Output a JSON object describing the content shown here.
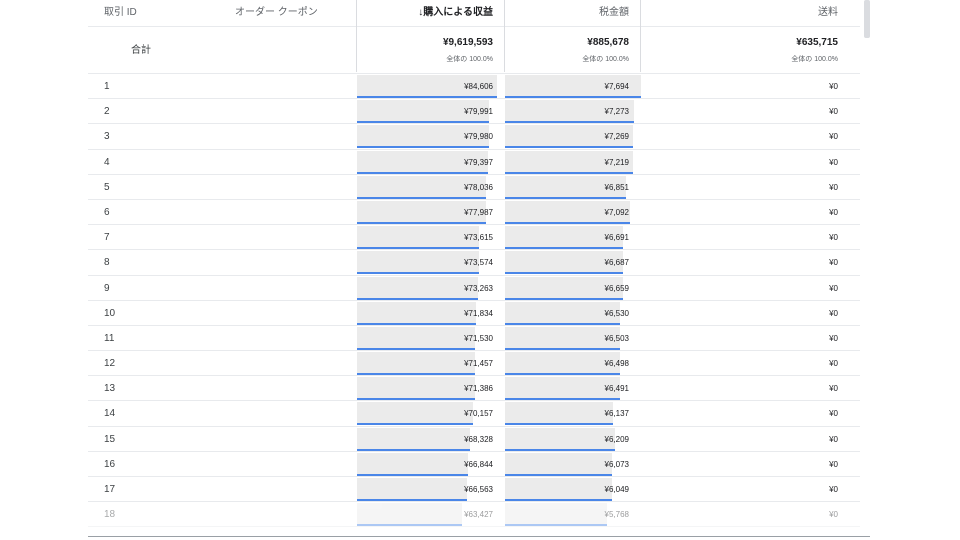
{
  "columns": {
    "transaction_id": "取引 ID",
    "order_coupon": "オーダー クーポン",
    "revenue": "↓購入による収益",
    "tax": "税金額",
    "shipping": "送料"
  },
  "totals": {
    "label": "合計",
    "revenue": "¥9,619,593",
    "revenue_pct": "全体の 100.0%",
    "tax": "¥885,678",
    "tax_pct": "全体の 100.0%",
    "shipping": "¥635,715",
    "shipping_pct": "全体の 100.0%"
  },
  "rows": [
    {
      "idx": "1",
      "revenue": "¥84,606",
      "tax": "¥7,694",
      "shipping": "¥0"
    },
    {
      "idx": "2",
      "revenue": "¥79,991",
      "tax": "¥7,273",
      "shipping": "¥0"
    },
    {
      "idx": "3",
      "revenue": "¥79,980",
      "tax": "¥7,269",
      "shipping": "¥0"
    },
    {
      "idx": "4",
      "revenue": "¥79,397",
      "tax": "¥7,219",
      "shipping": "¥0"
    },
    {
      "idx": "5",
      "revenue": "¥78,036",
      "tax": "¥6,851",
      "shipping": "¥0"
    },
    {
      "idx": "6",
      "revenue": "¥77,987",
      "tax": "¥7,092",
      "shipping": "¥0"
    },
    {
      "idx": "7",
      "revenue": "¥73,615",
      "tax": "¥6,691",
      "shipping": "¥0"
    },
    {
      "idx": "8",
      "revenue": "¥73,574",
      "tax": "¥6,687",
      "shipping": "¥0"
    },
    {
      "idx": "9",
      "revenue": "¥73,263",
      "tax": "¥6,659",
      "shipping": "¥0"
    },
    {
      "idx": "10",
      "revenue": "¥71,834",
      "tax": "¥6,530",
      "shipping": "¥0"
    },
    {
      "idx": "11",
      "revenue": "¥71,530",
      "tax": "¥6,503",
      "shipping": "¥0"
    },
    {
      "idx": "12",
      "revenue": "¥71,457",
      "tax": "¥6,498",
      "shipping": "¥0"
    },
    {
      "idx": "13",
      "revenue": "¥71,386",
      "tax": "¥6,491",
      "shipping": "¥0"
    },
    {
      "idx": "14",
      "revenue": "¥70,157",
      "tax": "¥6,137",
      "shipping": "¥0"
    },
    {
      "idx": "15",
      "revenue": "¥68,328",
      "tax": "¥6,209",
      "shipping": "¥0"
    },
    {
      "idx": "16",
      "revenue": "¥66,844",
      "tax": "¥6,073",
      "shipping": "¥0"
    },
    {
      "idx": "17",
      "revenue": "¥66,563",
      "tax": "¥6,049",
      "shipping": "¥0"
    },
    {
      "idx": "18",
      "revenue": "¥63,427",
      "tax": "¥5,768",
      "shipping": "¥0"
    }
  ],
  "colors": {
    "bar": "#4a86e8",
    "shade": "#ebebeb"
  }
}
